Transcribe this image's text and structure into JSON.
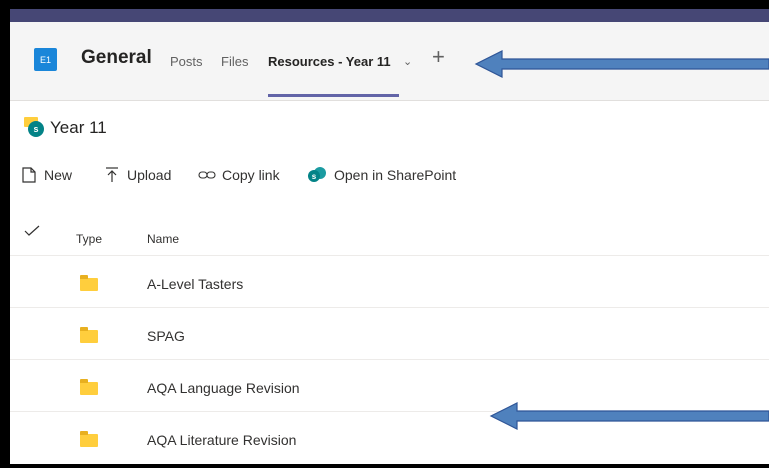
{
  "header": {
    "team_initials": "E1",
    "channel": "General",
    "tabs": [
      {
        "label": "Posts"
      },
      {
        "label": "Files"
      },
      {
        "label": "Resources - Year 11"
      }
    ],
    "active_tab_chevron": "chevron-down-icon",
    "add_tab_icon": "plus-icon"
  },
  "library": {
    "title": "Year 11",
    "icon": "sharepoint-folder-icon"
  },
  "commands": {
    "new": "New",
    "upload": "Upload",
    "copy_link": "Copy link",
    "open_sharepoint": "Open in SharePoint"
  },
  "list": {
    "columns": {
      "type": "Type",
      "name": "Name"
    },
    "rows": [
      {
        "name": "A-Level Tasters"
      },
      {
        "name": "SPAG"
      },
      {
        "name": "AQA Language Revision"
      },
      {
        "name": "AQA Literature Revision"
      }
    ]
  },
  "colors": {
    "accent": "#6264a7",
    "team_avatar": "#1a86d9",
    "annotation_arrow": "#4f81bd",
    "folder": "#ffce3d",
    "sharepoint": "#038387"
  }
}
